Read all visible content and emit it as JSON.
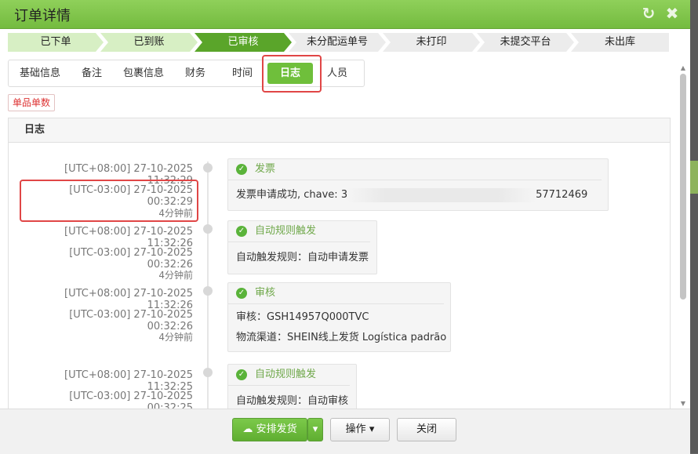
{
  "title": "订单详情",
  "title_icons": [
    "refresh-icon",
    "close-icon"
  ],
  "steps": [
    "已下单",
    "已到账",
    "已审核",
    "未分配运单号",
    "未打印",
    "未提交平台",
    "未出库"
  ],
  "tabs": [
    "基础信息",
    "备注",
    "包裹信息",
    "财务",
    "时间",
    "日志",
    "人员"
  ],
  "active_tab": "日志",
  "badge": "单品单数",
  "panel_title": "日志",
  "logs": [
    {
      "time1": "[UTC+08:00] 27-10-2025 11:32:29",
      "time2": "[UTC-03:00] 27-10-2025 00:32:29",
      "ago": "4分钟前",
      "title": "发票",
      "lines": [
        "发票申请成功, chave: 3",
        "57712469"
      ]
    },
    {
      "time1": "[UTC+08:00] 27-10-2025 11:32:26",
      "time2": "[UTC-03:00] 27-10-2025 00:32:26",
      "ago": "4分钟前",
      "title": "自动规则触发",
      "lines": [
        "自动触发规则：自动申请发票"
      ]
    },
    {
      "time1": "[UTC+08:00] 27-10-2025 11:32:26",
      "time2": "[UTC-03:00] 27-10-2025 00:32:26",
      "ago": "4分钟前",
      "title": "审核",
      "lines": [
        "审核：GSH14957Q000TVC",
        "物流渠道：SHEIN线上发货 Logística padrão"
      ]
    },
    {
      "time1": "[UTC+08:00] 27-10-2025 11:32:25",
      "time2": "[UTC-03:00] 27-10-2025 00:32:25",
      "ago": "",
      "title": "自动规则触发",
      "lines": [
        "自动触发规则：自动审核"
      ]
    }
  ],
  "footer": {
    "ship": "安排发货",
    "ops": "操作",
    "close": "关闭"
  },
  "colors": {
    "accent": "#6fbf3b",
    "highlight": "#e04646",
    "active_step": "#5aa52a"
  }
}
